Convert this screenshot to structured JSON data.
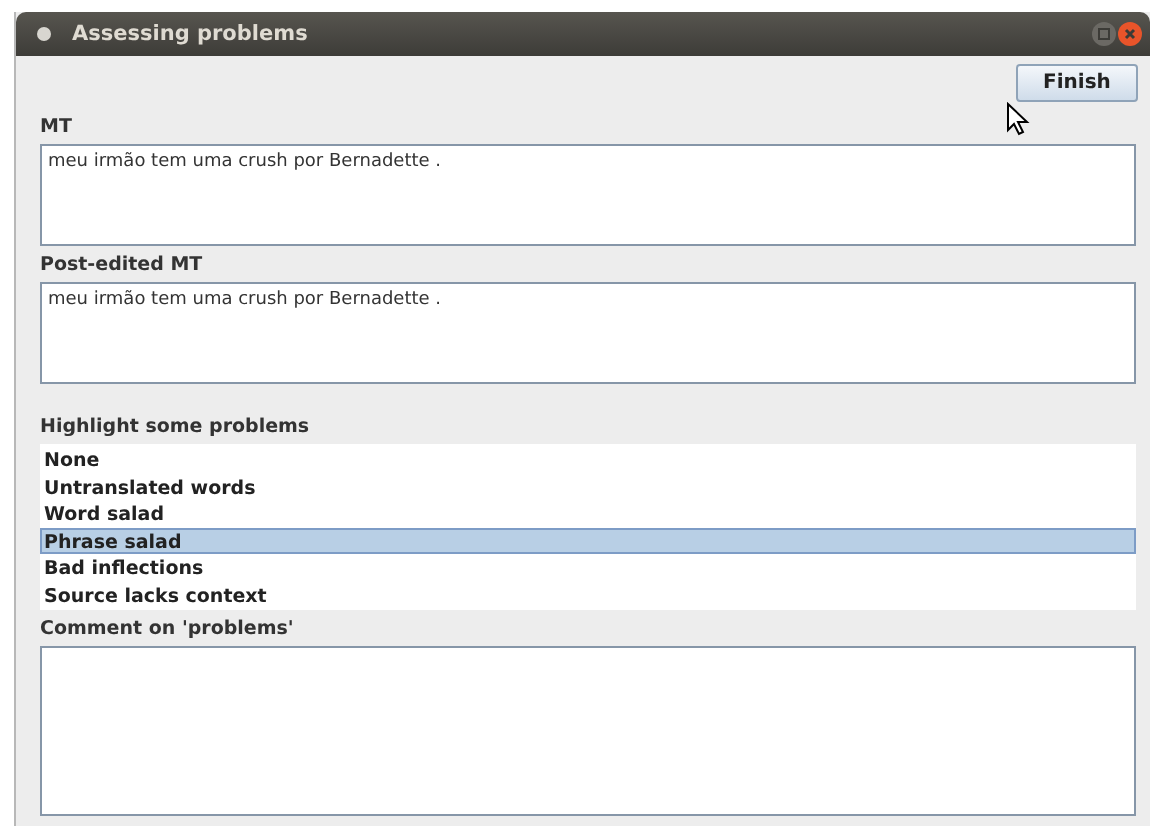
{
  "window": {
    "title": "Assessing problems"
  },
  "finish_button": "Finish",
  "fields": [
    {
      "label": "MT",
      "value": "meu irmão tem uma crush por Bernadette ."
    },
    {
      "label": "Post-edited MT",
      "value": "meu irmão tem uma crush por Bernadette ."
    }
  ],
  "problems": {
    "label": "Highlight some problems",
    "items": [
      {
        "label": "None",
        "selected": false
      },
      {
        "label": "Untranslated words",
        "selected": false
      },
      {
        "label": "Word salad",
        "selected": false
      },
      {
        "label": "Phrase salad",
        "selected": true
      },
      {
        "label": "Bad inflections",
        "selected": false
      },
      {
        "label": "Source lacks context",
        "selected": false
      }
    ]
  },
  "comment": {
    "label": "Comment on 'problems'"
  }
}
